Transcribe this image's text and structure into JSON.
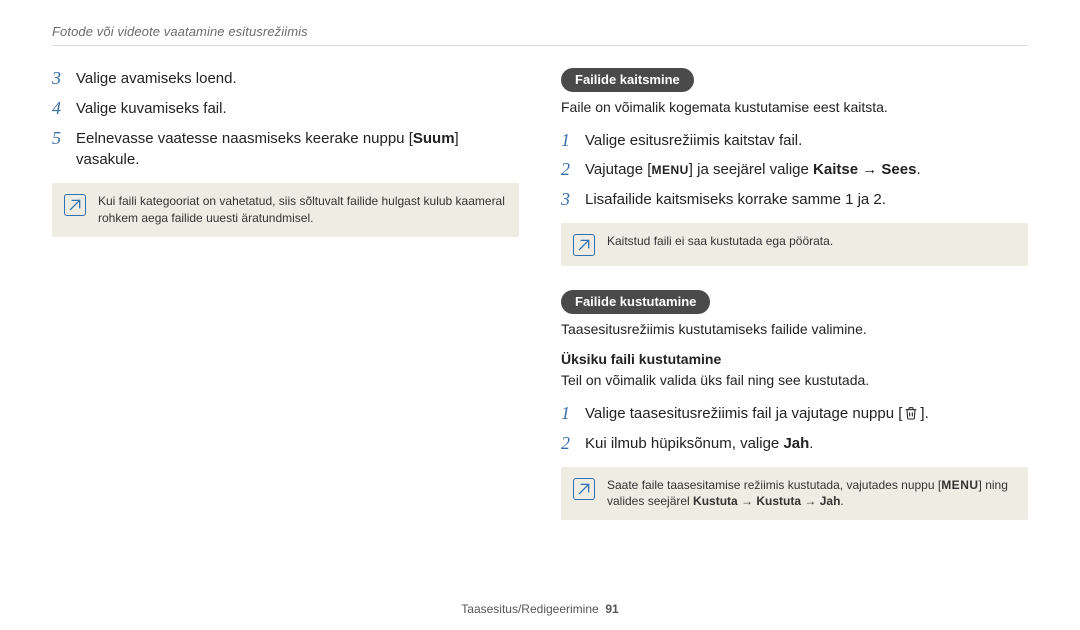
{
  "running_head": "Fotode või videote vaatamine esitusrežiimis",
  "left": {
    "steps": [
      {
        "num": "3",
        "text": "Valige avamiseks loend."
      },
      {
        "num": "4",
        "text": "Valige kuvamiseks fail."
      },
      {
        "num": "5",
        "pre": "Eelnevasse vaatesse naasmiseks keerake nuppu [",
        "bold": "Suum",
        "post": "] vasakule."
      }
    ],
    "note": "Kui faili kategooriat on vahetatud, siis sõltuvalt failide hulgast kulub kaameral rohkem aega failide uuesti äratundmisel."
  },
  "right": {
    "protect": {
      "pill": "Failide kaitsmine",
      "intro": "Faile on võimalik kogemata kustutamise eest kaitsta.",
      "steps": {
        "s1": {
          "num": "1",
          "text": "Valige esitusrežiimis kaitstav fail."
        },
        "s2": {
          "num": "2",
          "pre": "Vajutage [",
          "menu": "MENU",
          "mid": "] ja seejärel valige ",
          "bold1": "Kaitse",
          "arrow": " → ",
          "bold2": "Sees",
          "post": "."
        },
        "s3": {
          "num": "3",
          "text": "Lisafailide kaitsmiseks korrake samme 1 ja 2."
        }
      },
      "note": "Kaitstud faili ei saa kustutada ega pöörata."
    },
    "delete": {
      "pill": "Failide kustutamine",
      "intro": "Taasesitusrežiimis kustutamiseks failide valimine.",
      "subhead": "Üksiku faili kustutamine",
      "sub_intro": "Teil on võimalik valida üks fail ning see kustutada.",
      "steps": {
        "s1": {
          "num": "1",
          "pre": "Valige taasesitusrežiimis fail ja vajutage nuppu [",
          "post": "]."
        },
        "s2": {
          "num": "2",
          "pre": "Kui ilmub hüpiksõnum, valige ",
          "bold": "Jah",
          "post": "."
        }
      },
      "note": {
        "pre": "Saate faile taasesitamise režiimis kustutada, vajutades nuppu [",
        "menu": "MENU",
        "mid": "] ning valides seejärel ",
        "b1": "Kustuta",
        "a1": " → ",
        "b2": "Kustuta",
        "a2": " → ",
        "b3": "Jah",
        "post": "."
      }
    }
  },
  "footer": {
    "section": "Taasesitus/Redigeerimine",
    "page": "91"
  }
}
